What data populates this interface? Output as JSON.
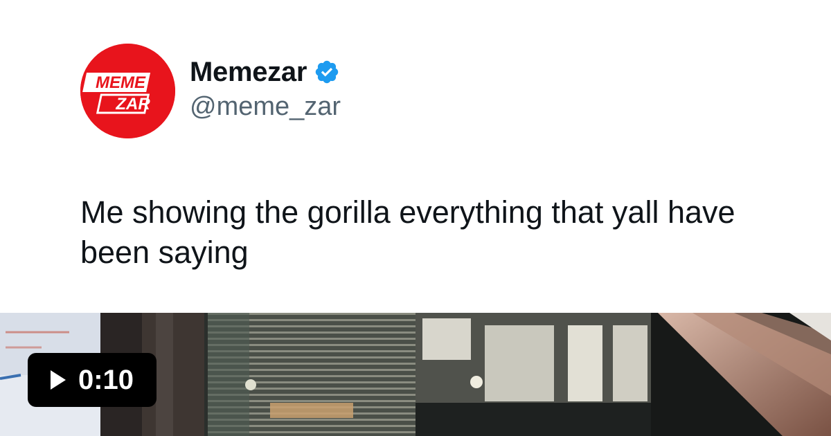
{
  "tweet": {
    "avatar_logo_line1": "MEME",
    "avatar_logo_line2": "ZAR",
    "display_name": "Memezar",
    "verified": true,
    "handle": "@meme_zar",
    "text": "Me showing the gorilla everything that yall have been saying"
  },
  "video": {
    "duration": "0:10",
    "play_icon": "play-icon"
  },
  "colors": {
    "avatar_red": "#e8141c",
    "verified_blue": "#1d9bf0",
    "text_primary": "#0f1419",
    "text_secondary": "#536471"
  }
}
